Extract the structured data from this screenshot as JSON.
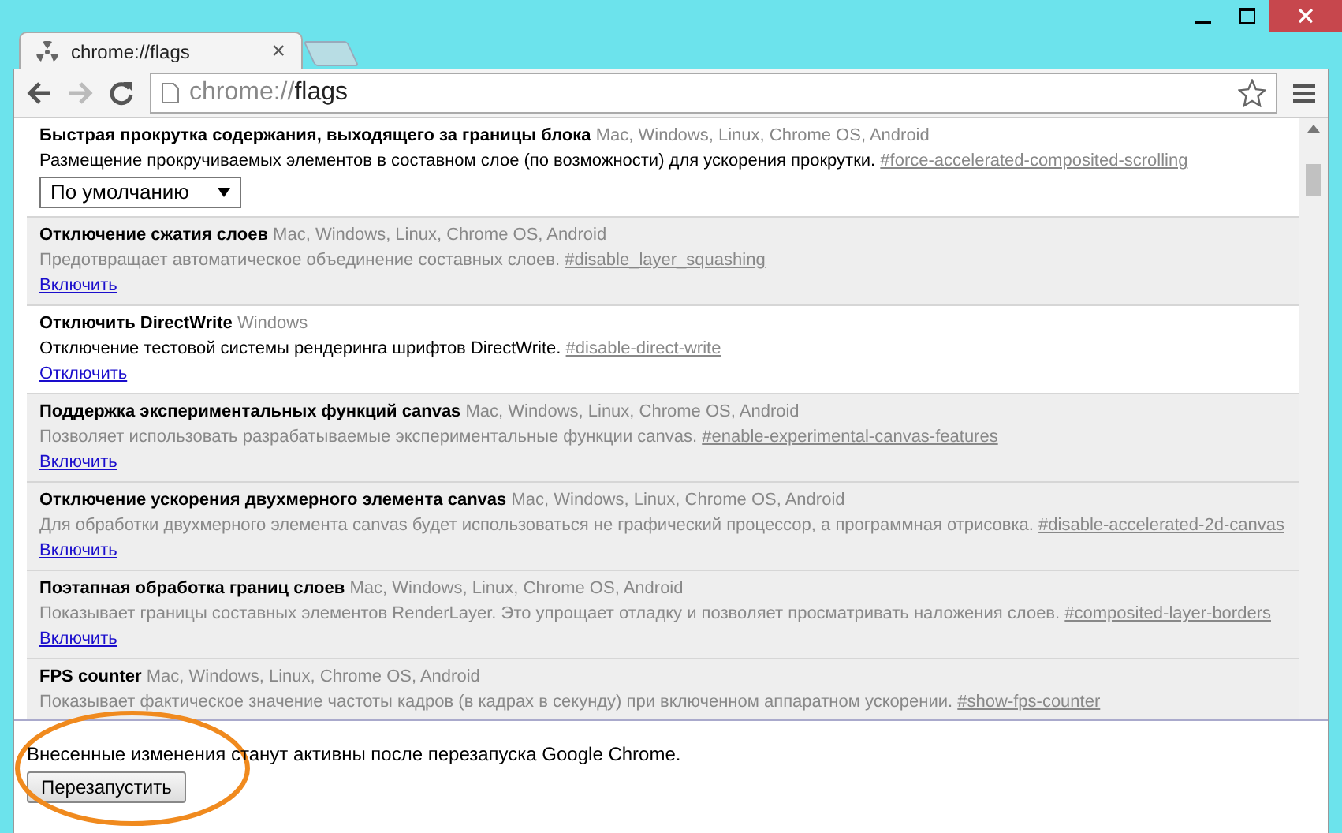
{
  "tabs": [
    {
      "title": "chrome://flags",
      "selected": true,
      "close": "×"
    }
  ],
  "toolbar": {
    "forward_disabled": true,
    "address": {
      "scheme": "chrome://",
      "path": "flags"
    }
  },
  "flags": [
    {
      "title": "Быстрая прокрутка содержания, выходящего за границы блока",
      "platforms": "Mac, Windows, Linux, Chrome OS, Android",
      "description": "Размещение прокручиваемых элементов в составном слое (по возможности) для ускорения прокрутки.",
      "anchor": "#force-accelerated-composited-scrolling",
      "enabled": true,
      "kind": "select",
      "action": "По умолчанию"
    },
    {
      "title": "Отключение сжатия слоев",
      "platforms": "Mac, Windows, Linux, Chrome OS, Android",
      "description": "Предотвращает автоматическое объединение составных слоев.",
      "anchor": "#disable_layer_squashing",
      "enabled": false,
      "kind": "link",
      "action": "Включить"
    },
    {
      "title": "Отключить DirectWrite",
      "platforms": "Windows",
      "description": "Отключение тестовой системы рендеринга шрифтов DirectWrite.",
      "anchor": "#disable-direct-write",
      "enabled": true,
      "kind": "link",
      "action": "Отключить"
    },
    {
      "title": "Поддержка экспериментальных функций canvas",
      "platforms": "Mac, Windows, Linux, Chrome OS, Android",
      "description": "Позволяет использовать разрабатываемые экспериментальные функции canvas.",
      "anchor": "#enable-experimental-canvas-features",
      "enabled": false,
      "kind": "link",
      "action": "Включить"
    },
    {
      "title": "Отключение ускорения двухмерного элемента canvas",
      "platforms": "Mac, Windows, Linux, Chrome OS, Android",
      "description": "Для обработки двухмерного элемента canvas будет использоваться не графический процессор, а программная отрисовка.",
      "anchor": "#disable-accelerated-2d-canvas",
      "enabled": false,
      "kind": "link",
      "action": "Включить"
    },
    {
      "title": "Поэтапная обработка границ слоев",
      "platforms": "Mac, Windows, Linux, Chrome OS, Android",
      "description": "Показывает границы составных элементов RenderLayer. Это упрощает отладку и позволяет просматривать наложения слоев.",
      "anchor": "#composited-layer-borders",
      "enabled": false,
      "kind": "link",
      "action": "Включить"
    },
    {
      "title": "FPS counter",
      "platforms": "Mac, Windows, Linux, Chrome OS, Android",
      "description": "Показывает фактическое значение частоты кадров (в кадрах в секунду) при включенном аппаратном ускорении.",
      "anchor": "#show-fps-counter",
      "enabled": false,
      "kind": "none"
    }
  ],
  "footer": {
    "message": "Внесенные изменения станут активны после перезапуска Google Chrome.",
    "button": "Перезапустить",
    "highlighted": true
  }
}
